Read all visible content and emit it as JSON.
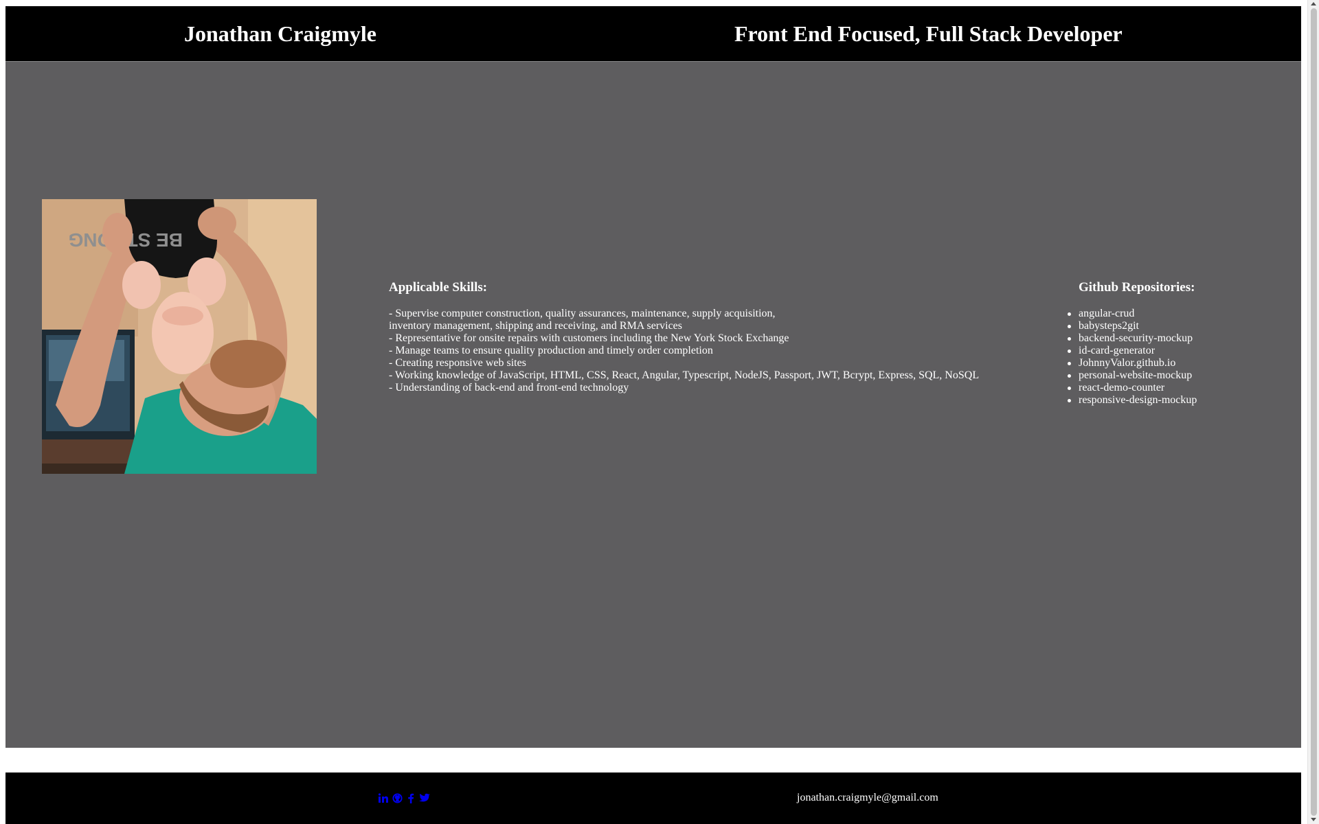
{
  "header": {
    "name": "Jonathan Craigmyle",
    "role": "Front End Focused, Full Stack Developer"
  },
  "skills": {
    "title": "Applicable Skills:",
    "lines": [
      "- Supervise computer construction, quality assurances, maintenance, supply acquisition,",
      "inventory management, shipping and receiving, and RMA services",
      "- Representative for onsite repairs with customers including the New York Stock Exchange",
      "- Manage teams to ensure quality production and timely order completion",
      "- Creating responsive web sites",
      "- Working knowledge of JavaScript, HTML, CSS, React, Angular, Typescript, NodeJS, Passport, JWT, Bcrypt, Express, SQL, NoSQL",
      "- Understanding of back-end and front-end technology"
    ]
  },
  "repos": {
    "title": "Github Repositories:",
    "items": [
      "angular-crud",
      "babysteps2git",
      "backend-security-mockup",
      "id-card-generator",
      "JohnnyValor.github.io",
      "personal-website-mockup",
      "react-demo-counter",
      "responsive-design-mockup"
    ]
  },
  "photo": {
    "shirt_text": "BE STRONG"
  },
  "footer": {
    "social": [
      "linkedin-icon",
      "github-icon",
      "facebook-icon",
      "twitter-icon"
    ],
    "email": "jonathan.craigmyle@gmail.com"
  },
  "colors": {
    "header_bg": "#000000",
    "main_bg": "#5e5d5f",
    "text": "#ffffff",
    "link": "#0000ee"
  }
}
